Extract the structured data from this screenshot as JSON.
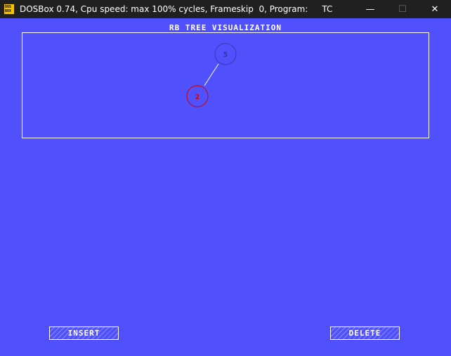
{
  "window": {
    "title": "DOSBox 0.74, Cpu speed: max 100% cycles, Frameskip  0, Program:",
    "program": "TC",
    "icon_lines": [
      "DOS",
      "BOX"
    ],
    "controls": {
      "minimize": "—",
      "maximize": "☐",
      "close": "✕"
    }
  },
  "visualization": {
    "title": "RB TREE VISUALIZATION",
    "nodes": [
      {
        "key": "5",
        "color_name": "black",
        "stroke": "#3838b8",
        "text_color": "#3030a0"
      },
      {
        "key": "2",
        "color_name": "red",
        "stroke": "#d00000",
        "text_color": "#d00000"
      }
    ],
    "edge_color": "#ffffff"
  },
  "buttons": {
    "insert": "INSERT",
    "delete": "DELETE"
  },
  "colors": {
    "background": "#5050fc",
    "titlebar": "#202020"
  }
}
